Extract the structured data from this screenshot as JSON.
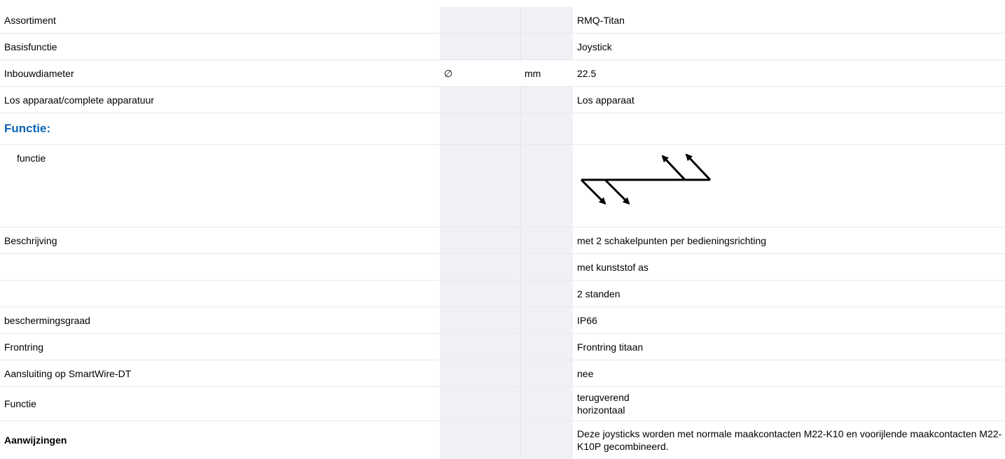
{
  "rows": [
    {
      "label": "Assortiment",
      "symbol": "",
      "unit": "",
      "value": "RMQ-Titan"
    },
    {
      "label": "Basisfunctie",
      "symbol": "",
      "unit": "",
      "value": "Joystick"
    },
    {
      "label": "Inbouwdiameter",
      "symbol": "∅",
      "unit": "mm",
      "value": "22.5"
    },
    {
      "label": "Los apparaat/complete apparatuur",
      "symbol": "",
      "unit": "",
      "value": "Los apparaat"
    }
  ],
  "section_title": "Functie:",
  "function_row": {
    "label": "functie",
    "figure": "joystick-function-symbol"
  },
  "rows2": [
    {
      "label": "Beschrijving",
      "value": "met 2 schakelpunten per bedieningsrichting"
    },
    {
      "label": "",
      "value": "met kunststof as"
    },
    {
      "label": "",
      "value": "2 standen"
    },
    {
      "label": "beschermingsgraad",
      "value": "IP66"
    },
    {
      "label": "Frontring",
      "value": "Frontring titaan"
    },
    {
      "label": "Aansluiting op SmartWire-DT",
      "value": "nee"
    }
  ],
  "functie_row": {
    "label": "Functie",
    "value_line1": "terugverend",
    "value_line2": "horizontaal"
  },
  "notes_row": {
    "label": "Aanwijzingen",
    "value": "Deze joysticks worden met normale maakcontacten M22-K10 en voorijlende maakcontacten M22-K10P gecombineerd."
  }
}
